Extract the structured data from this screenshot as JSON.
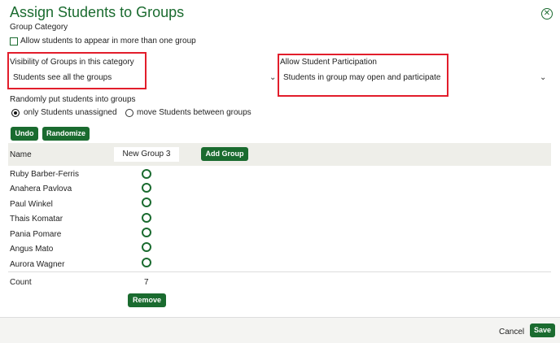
{
  "dialog": {
    "title": "Assign Students to Groups",
    "close_icon": "close-icon",
    "group_category_label": "Group Category",
    "allow_multiple_label": "Allow students to appear in more than one group"
  },
  "visibility": {
    "label": "Visibility of Groups in this category",
    "value": "Students see all the groups"
  },
  "participation": {
    "label": "Allow Student Participation",
    "value": "Students in group may open and participate"
  },
  "random": {
    "label": "Randomly put students into groups",
    "option_unassigned": "only Students unassigned",
    "option_move": "move Students between groups",
    "selected": "only Students unassigned"
  },
  "actions": {
    "undo": "Undo",
    "randomize": "Randomize",
    "add_group": "Add Group",
    "remove": "Remove"
  },
  "table": {
    "name_header": "Name",
    "group_name": "New Group 3",
    "students": [
      "Ruby Barber-Ferris",
      "Anahera Pavlova",
      "Paul Winkel",
      "Thais Komatar",
      "Pania Pomare",
      "Angus Mato",
      "Aurora Wagner"
    ],
    "count_label": "Count",
    "count_value": "7"
  },
  "footer": {
    "cancel": "Cancel",
    "save": "Save"
  },
  "colors": {
    "accent": "#1a6b2f",
    "highlight": "#e21d2b"
  }
}
